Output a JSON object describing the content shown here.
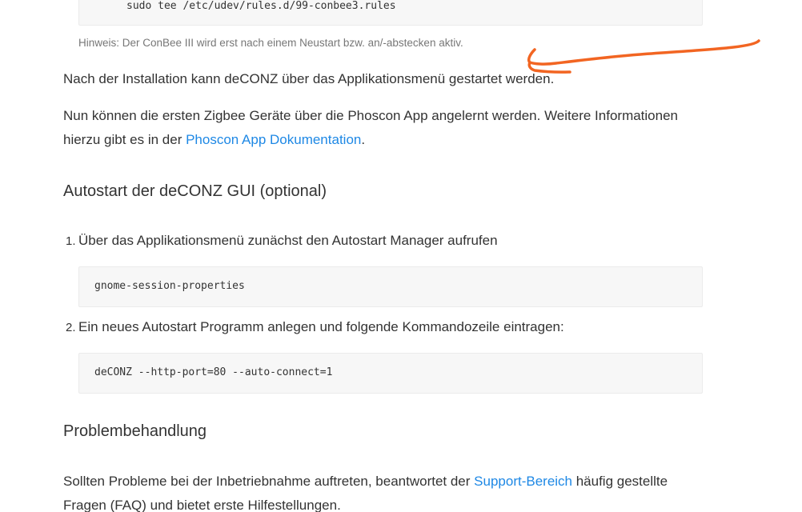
{
  "code_blocks": {
    "udev_rules": "sudo tee /etc/udev/rules.d/99-conbee3.rules",
    "gnome_session": "gnome-session-properties",
    "deconz_command": "deCONZ --http-port=80 --auto-connect=1"
  },
  "note": "Hinweis: Der ConBee III wird erst nach einem Neustart bzw. an/-abstecken aktiv.",
  "paragraphs": {
    "install": "Nach der Installation kann deCONZ über das Applikationsmenü gestartet werden.",
    "zigbee_line1": "Nun können die ersten Zigbee Geräte über die Phoscon App angelernt werden. Weitere Informationen",
    "zigbee_line2_prefix": "hierzu gibt es in der ",
    "zigbee_link": "Phoscon App Dokumentation",
    "zigbee_line2_suffix": ".",
    "problem_line1_prefix": "Sollten Probleme bei der Inbetriebnahme auftreten, beantwortet der ",
    "problem_link": "Support-Bereich",
    "problem_line1_suffix": " häufig gestellte",
    "problem_line2": "Fragen (FAQ) und bietet erste Hilfestellungen."
  },
  "headings": {
    "autostart": "Autostart der deCONZ GUI (optional)",
    "troubleshooting": "Problembehandlung"
  },
  "steps": [
    {
      "number": "1.",
      "text": "Über das Applikationsmenü zunächst den Autostart Manager aufrufen"
    },
    {
      "number": "2.",
      "text": "Ein neues Autostart Programm anlegen und folgende Kommandozeile eintragen:"
    }
  ],
  "colors": {
    "link": "#1e88e5",
    "annotation": "#f26522",
    "code_bg": "#f7f7f7"
  }
}
